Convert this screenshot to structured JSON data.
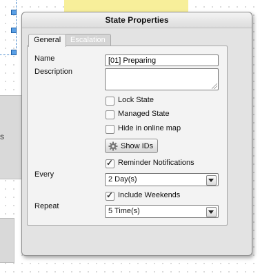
{
  "dialog": {
    "title": "State Properties"
  },
  "tabs": [
    {
      "label": "General",
      "active": true
    },
    {
      "label": "Escalation",
      "active": false
    }
  ],
  "canvas": {
    "side_label": "s"
  },
  "general": {
    "name_label": "Name",
    "name_value": "[01] Preparing",
    "description_label": "Description",
    "description_value": "",
    "lock_state": {
      "label": "Lock State",
      "checked": false
    },
    "managed_state": {
      "label": "Managed State",
      "checked": false
    },
    "hide_online_map": {
      "label": "Hide in online map",
      "checked": false
    },
    "show_ids_button": {
      "label": "Show IDs",
      "icon": "gear-icon"
    },
    "reminder_notifications": {
      "label": "Reminder Notifications",
      "checked": true
    },
    "every_label": "Every",
    "every_value": "2 Day(s)",
    "include_weekends": {
      "label": "Include Weekends",
      "checked": true
    },
    "repeat_label": "Repeat",
    "repeat_value": "5 Time(s)"
  },
  "colors": {
    "background_tag": "#f7ef9a",
    "selection_blue": "#4b8ccf"
  }
}
